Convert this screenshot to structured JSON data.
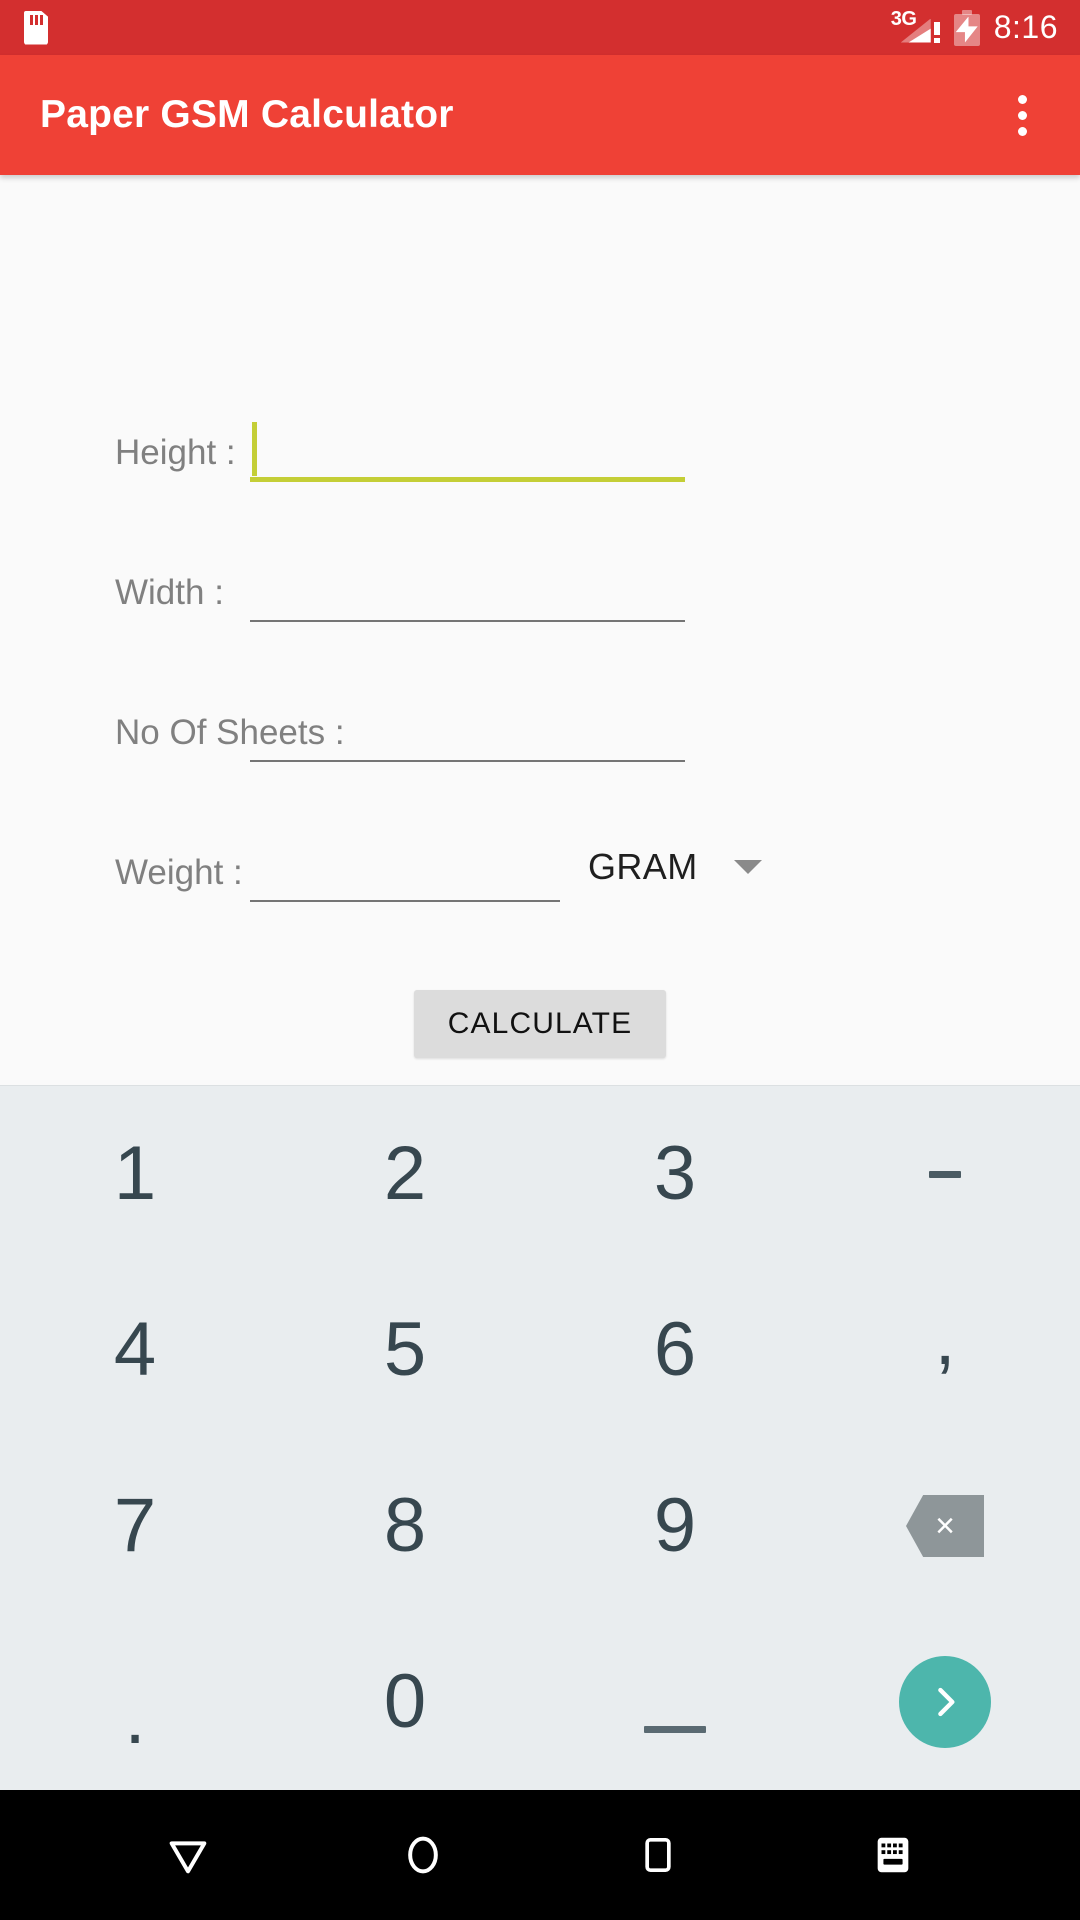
{
  "status_bar": {
    "sd_card_icon": "sd-card-icon",
    "network_label": "3G",
    "network_icon": "signal-bars-icon",
    "network_warning": "!",
    "battery_icon": "battery-charging-icon",
    "time": "8:16"
  },
  "app_bar": {
    "title": "Paper GSM Calculator",
    "overflow_icon": "more-vertical-icon",
    "background": "#EF4136"
  },
  "form": {
    "accent_color": "#C4CE36",
    "fields": [
      {
        "label": "Height :",
        "value": "",
        "placeholder": "",
        "focused": true,
        "name": "height"
      },
      {
        "label": "Width :",
        "value": "",
        "placeholder": "",
        "focused": false,
        "name": "width"
      },
      {
        "label": "No Of Sheets :",
        "value": "",
        "placeholder": "",
        "focused": false,
        "name": "sheets"
      },
      {
        "label": "Weight :",
        "value": "",
        "placeholder": "",
        "focused": false,
        "name": "weight"
      }
    ],
    "unit_spinner": {
      "selected": "GRAM",
      "arrow_icon": "chevron-down-icon"
    },
    "calculate_button": "CALCULATE"
  },
  "keyboard": {
    "background": "#E9EDEF",
    "enter_color": "#4DB6AC",
    "rows": [
      [
        {
          "label": "1",
          "type": "digit"
        },
        {
          "label": "2",
          "type": "digit"
        },
        {
          "label": "3",
          "type": "digit"
        },
        {
          "label": "-",
          "type": "symbol"
        }
      ],
      [
        {
          "label": "4",
          "type": "digit"
        },
        {
          "label": "5",
          "type": "digit"
        },
        {
          "label": "6",
          "type": "digit"
        },
        {
          "label": ",",
          "type": "symbol"
        }
      ],
      [
        {
          "label": "7",
          "type": "digit"
        },
        {
          "label": "8",
          "type": "digit"
        },
        {
          "label": "9",
          "type": "digit"
        },
        {
          "label": "",
          "type": "backspace"
        }
      ],
      [
        {
          "label": ".",
          "type": "symbol"
        },
        {
          "label": "0",
          "type": "digit"
        },
        {
          "label": "_",
          "type": "symbol"
        },
        {
          "label": "",
          "type": "enter"
        }
      ]
    ]
  },
  "nav_bar": {
    "back_icon": "hide-keyboard-down-icon",
    "home_icon": "home-circle-icon",
    "recents_icon": "recents-square-icon",
    "keyboard_switch_icon": "keyboard-switcher-icon"
  }
}
